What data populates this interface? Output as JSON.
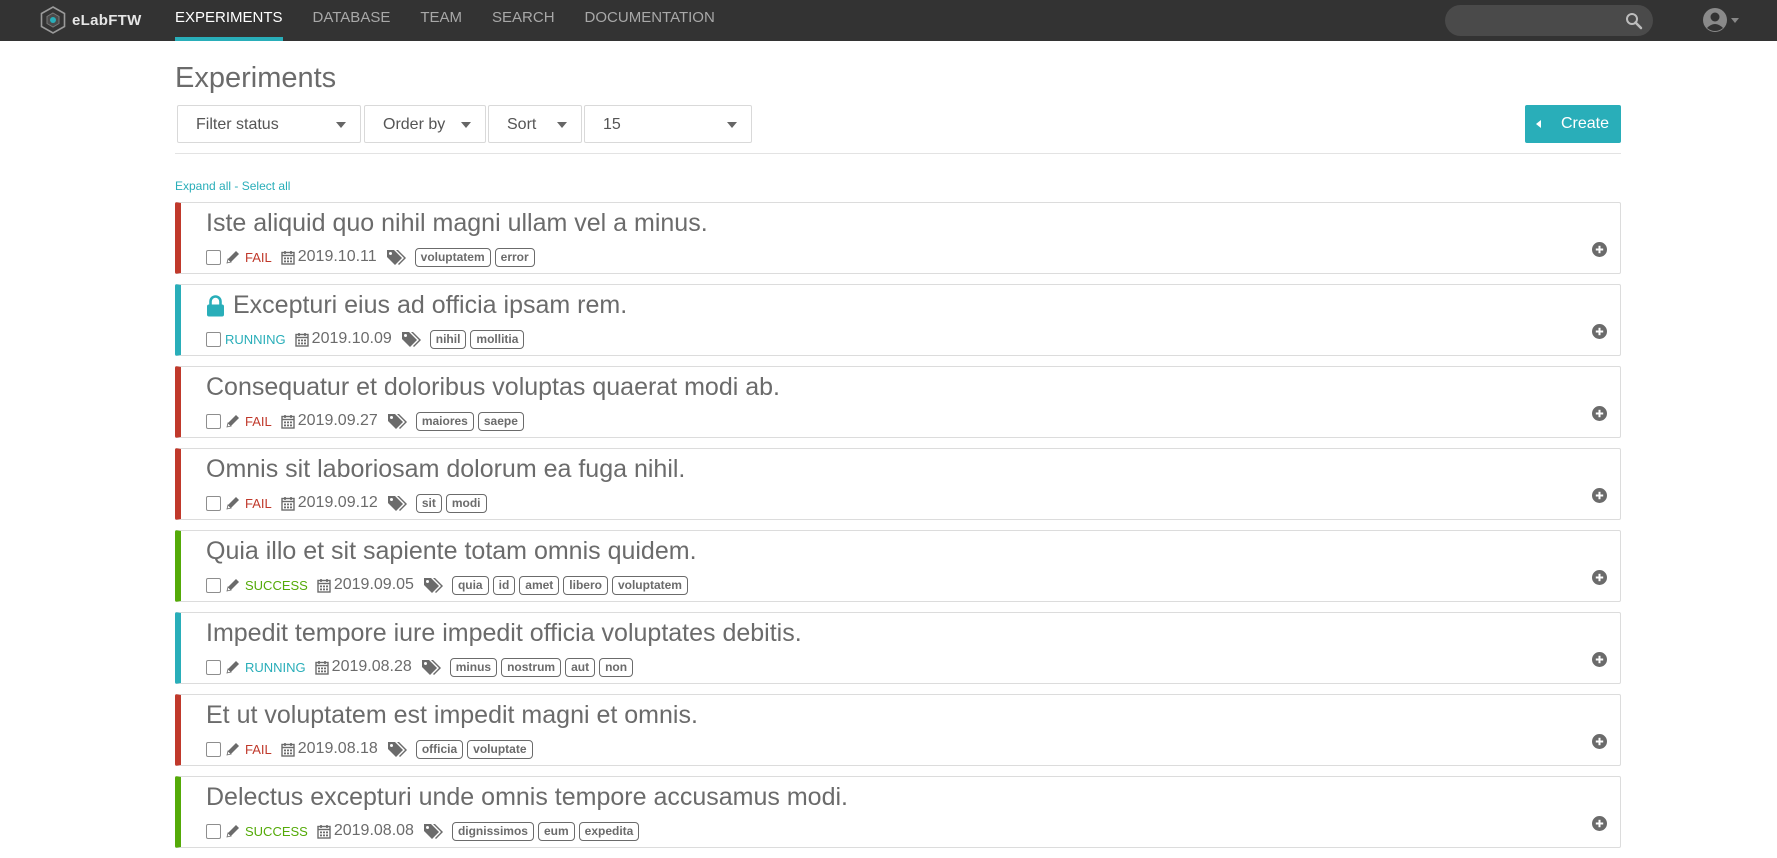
{
  "app": {
    "brand": "eLabFTW"
  },
  "nav": {
    "items": [
      {
        "label": "EXPERIMENTS",
        "active": true
      },
      {
        "label": "DATABASE"
      },
      {
        "label": "TEAM"
      },
      {
        "label": "SEARCH"
      },
      {
        "label": "DOCUMENTATION"
      }
    ]
  },
  "search": {
    "placeholder": "",
    "value": ""
  },
  "page": {
    "title": "Experiments"
  },
  "toolbar": {
    "filter_status": "Filter status",
    "order_by": "Order by",
    "sort": "Sort",
    "limit": "15",
    "create_label": "Create"
  },
  "links": {
    "expand_all": "Expand all",
    "separator": " - ",
    "select_all": "Select all"
  },
  "colors": {
    "accent": "#29aeb9",
    "fail": "#c0392b",
    "running": "#29aeb9",
    "success": "#54aa08",
    "navbar": "#333333"
  },
  "experiments": [
    {
      "title": "Iste aliquid quo nihil magni ullam vel a minus.",
      "status": "FAIL",
      "status_color": "#c0392b",
      "date": "2019.10.11",
      "tags": [
        "voluptatem",
        "error"
      ],
      "locked": false
    },
    {
      "title": "Excepturi eius ad officia ipsam rem.",
      "status": "RUNNING",
      "status_color": "#29aeb9",
      "date": "2019.10.09",
      "tags": [
        "nihil",
        "mollitia"
      ],
      "locked": true
    },
    {
      "title": "Consequatur et doloribus voluptas quaerat modi ab.",
      "status": "FAIL",
      "status_color": "#c0392b",
      "date": "2019.09.27",
      "tags": [
        "maiores",
        "saepe"
      ],
      "locked": false
    },
    {
      "title": "Omnis sit laboriosam dolorum ea fuga nihil.",
      "status": "FAIL",
      "status_color": "#c0392b",
      "date": "2019.09.12",
      "tags": [
        "sit",
        "modi"
      ],
      "locked": false
    },
    {
      "title": "Quia illo et sit sapiente totam omnis quidem.",
      "status": "SUCCESS",
      "status_color": "#54aa08",
      "date": "2019.09.05",
      "tags": [
        "quia",
        "id",
        "amet",
        "libero",
        "voluptatem"
      ],
      "locked": false
    },
    {
      "title": "Impedit tempore iure impedit officia voluptates debitis.",
      "status": "RUNNING",
      "status_color": "#29aeb9",
      "date": "2019.08.28",
      "tags": [
        "minus",
        "nostrum",
        "aut",
        "non"
      ],
      "locked": false
    },
    {
      "title": "Et ut voluptatem est impedit magni et omnis.",
      "status": "FAIL",
      "status_color": "#c0392b",
      "date": "2019.08.18",
      "tags": [
        "officia",
        "voluptate"
      ],
      "locked": false
    },
    {
      "title": "Delectus excepturi unde omnis tempore accusamus modi.",
      "status": "SUCCESS",
      "status_color": "#54aa08",
      "date": "2019.08.08",
      "tags": [
        "dignissimos",
        "eum",
        "expedita"
      ],
      "locked": false
    }
  ]
}
